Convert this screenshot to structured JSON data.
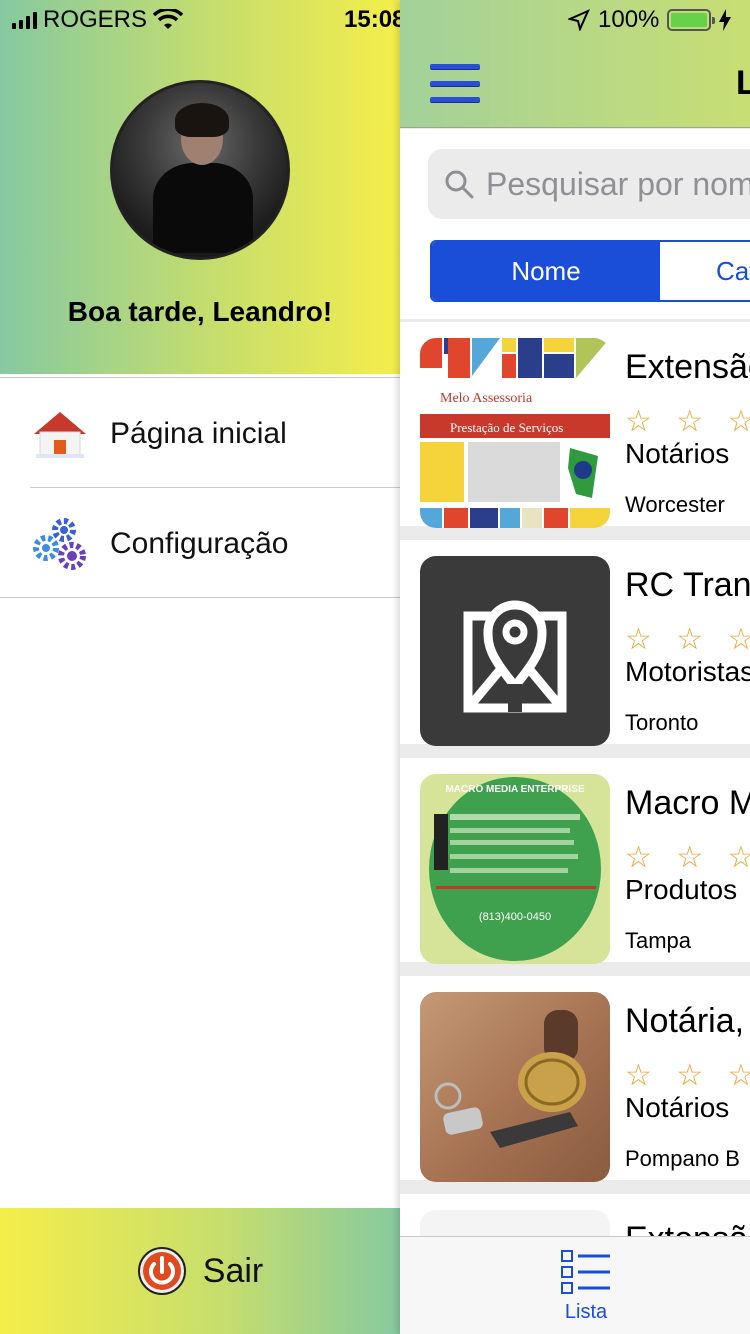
{
  "status_bar": {
    "carrier": "ROGERS",
    "time": "15:08",
    "battery": "100%"
  },
  "drawer": {
    "greeting": "Boa tarde, Leandro!",
    "menu": [
      {
        "label": "Página inicial",
        "icon": "house-icon"
      },
      {
        "label": "Configuração",
        "icon": "gears-icon"
      }
    ],
    "logout_label": "Sair",
    "logout_icon": "power-icon"
  },
  "main": {
    "title": "L",
    "search_placeholder": "Pesquisar por nome",
    "segments": [
      "Nome",
      "Categoria"
    ],
    "listings": [
      {
        "title": "Extensão",
        "stars": "☆ ☆ ☆ ☆",
        "category": "Notários",
        "city": "Worcester",
        "thumb_text": {
          "name": "Melo Assessoria",
          "service": "Prestação de Serviços"
        }
      },
      {
        "title": "RC Trans",
        "stars": "☆ ☆ ☆ ☆",
        "category": "Motoristas",
        "city": "Toronto"
      },
      {
        "title": "Macro M",
        "stars": "☆ ☆ ☆ ☆",
        "category": "Produtos",
        "city": "Tampa",
        "thumb_text": {
          "name": "MACRO MEDIA ENTERPRISE",
          "phone": "(813)400-0450"
        }
      },
      {
        "title": "Notária,",
        "stars": "☆ ☆ ☆ ☆",
        "category": "Notários",
        "city": "Pompano B"
      },
      {
        "title": "Extensão",
        "stars": "",
        "category": "",
        "city": ""
      }
    ],
    "tab_label": "Lista"
  },
  "colors": {
    "accent": "#1a4ed8",
    "star": "#f0a436",
    "gradient_green": "#86c9a0",
    "gradient_yellow": "#f4ee4a"
  }
}
